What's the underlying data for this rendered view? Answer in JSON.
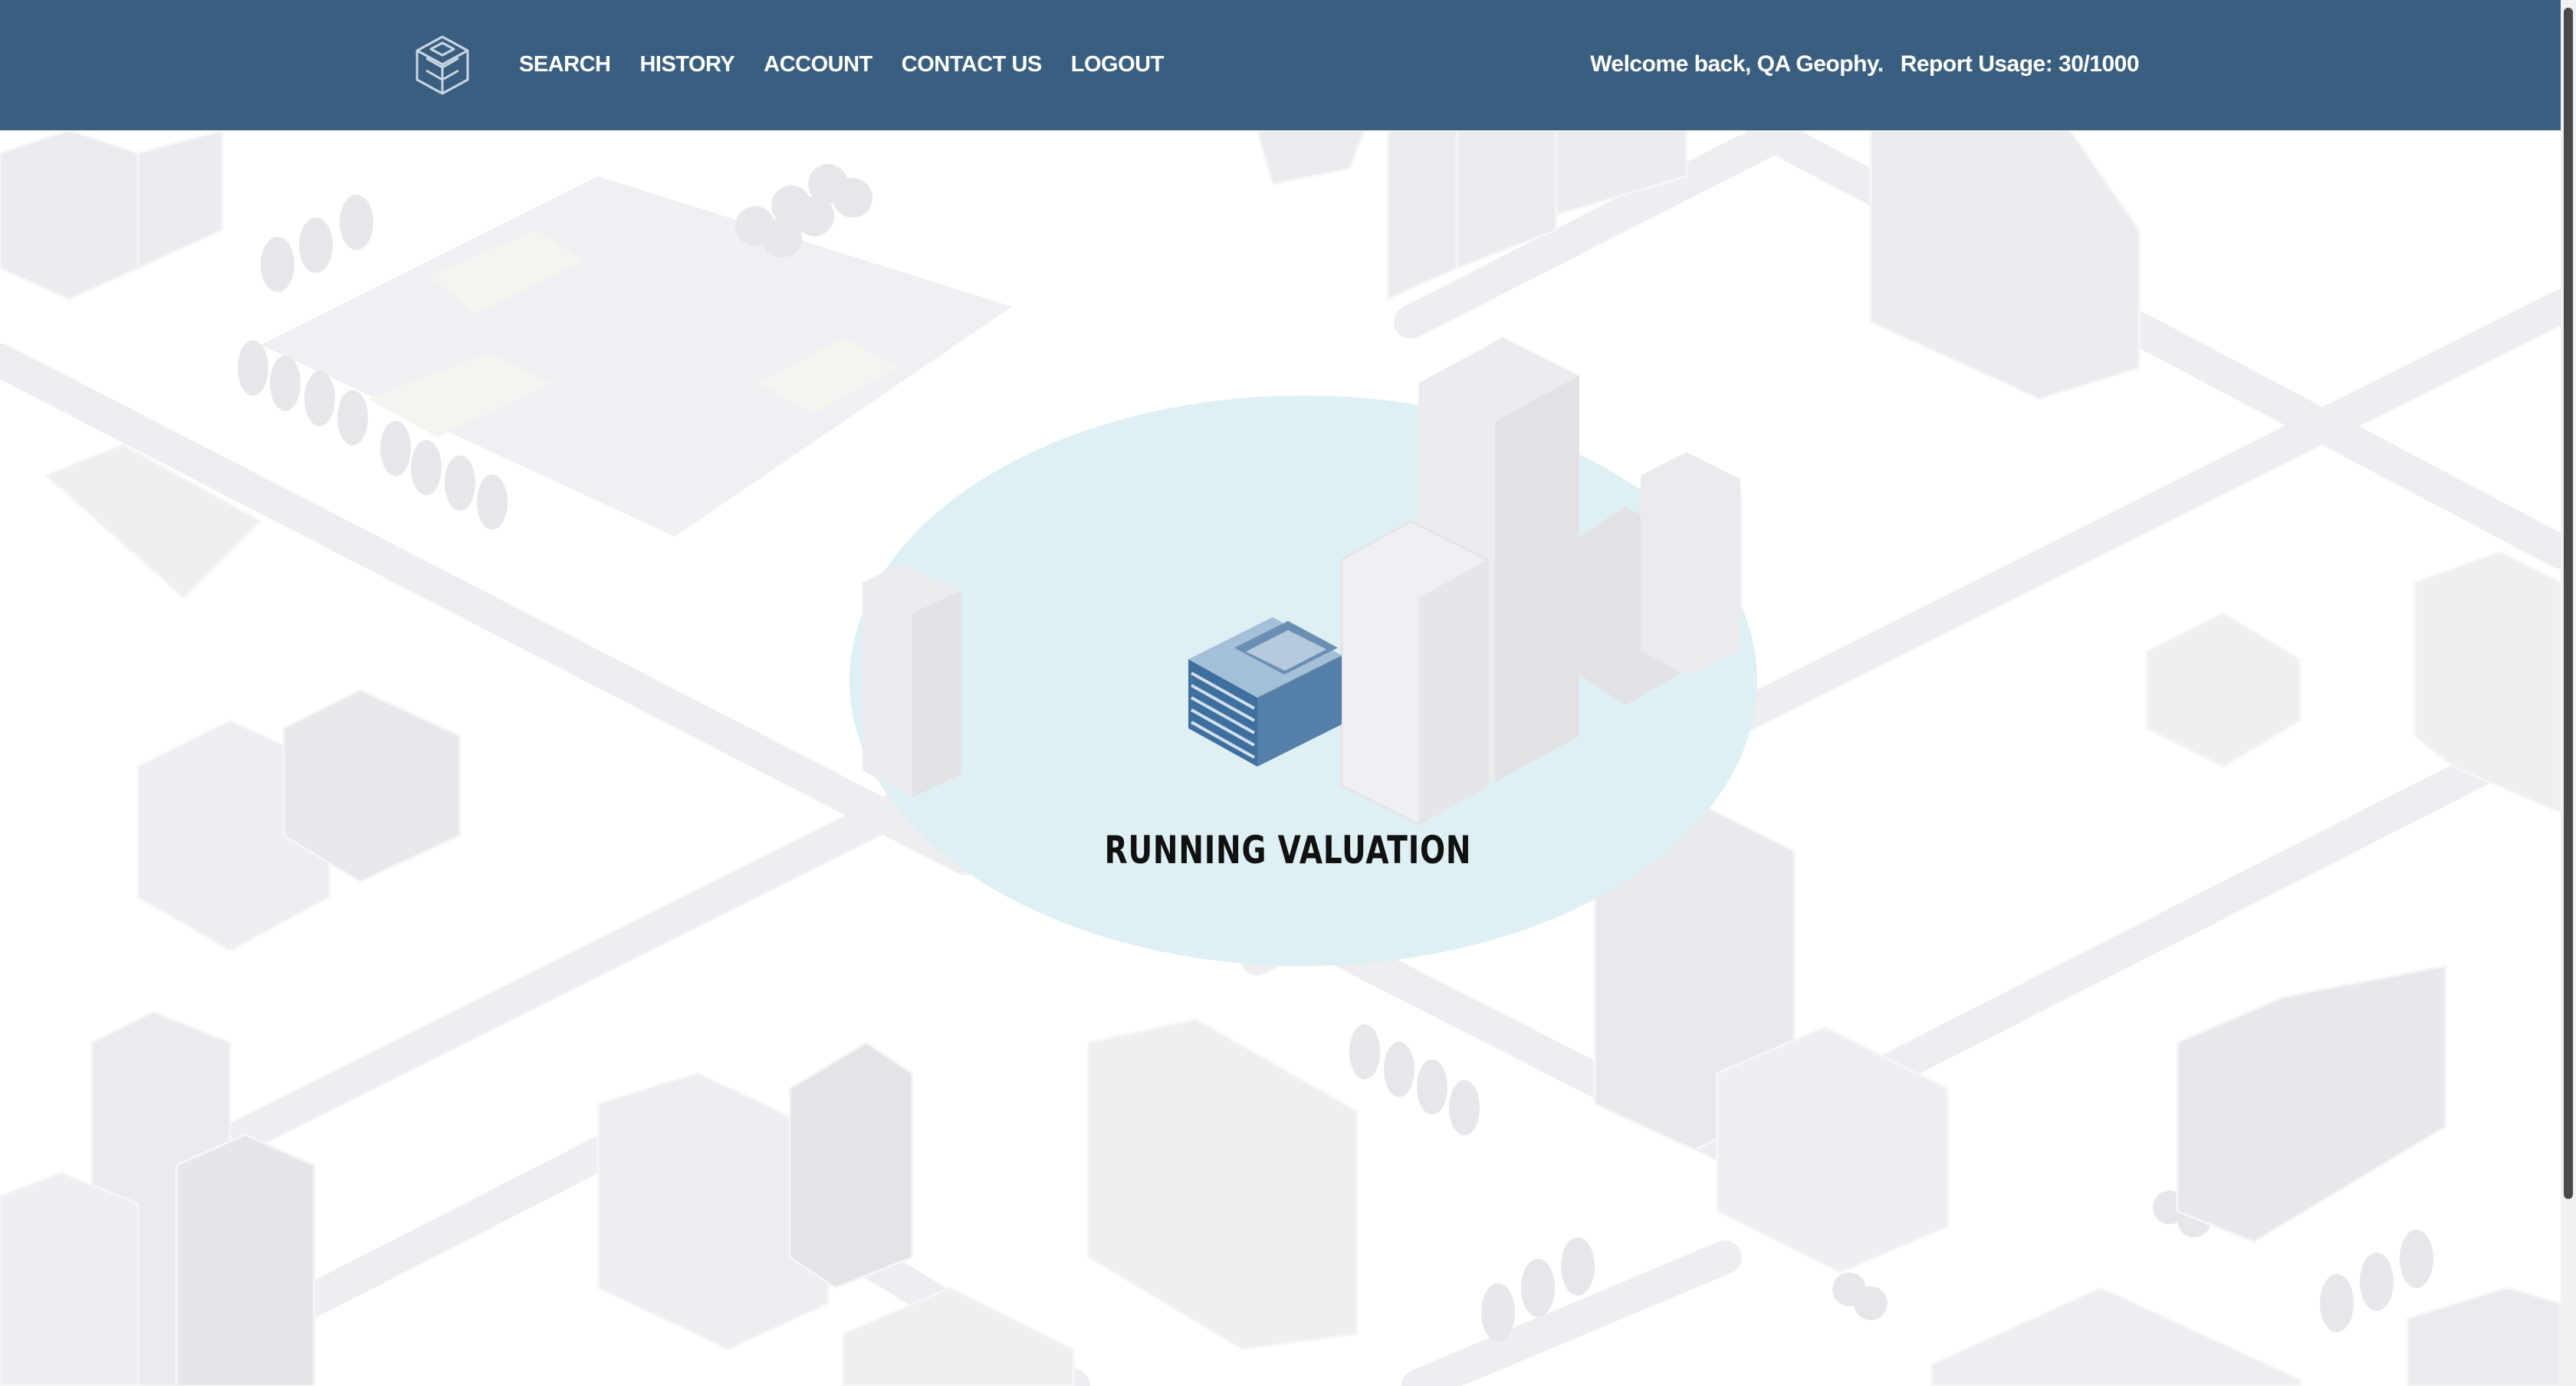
{
  "nav": {
    "items": [
      {
        "label": "SEARCH"
      },
      {
        "label": "HISTORY"
      },
      {
        "label": "ACCOUNT"
      },
      {
        "label": "CONTACT US"
      },
      {
        "label": "LOGOUT"
      }
    ]
  },
  "user": {
    "welcome": "Welcome back, QA Geophy.",
    "usage": "Report Usage: 30/1000"
  },
  "loader": {
    "status": "RUNNING VALUATION"
  },
  "colors": {
    "header": "#3a5e80",
    "circle": "#dff0f4",
    "building_accent": "#5b85ad"
  },
  "icons": [
    "logo-cube-icon",
    "building-loader-icon"
  ]
}
